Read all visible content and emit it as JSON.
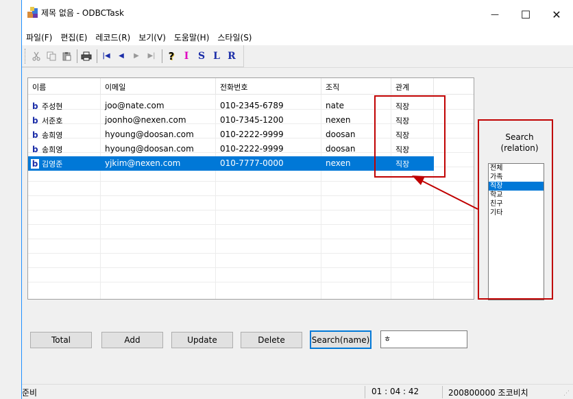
{
  "window": {
    "title": "제목 없음 - ODBCTask",
    "minimize_glyph": "—",
    "maximize_glyph": "☐",
    "close_glyph": "✕"
  },
  "menu": [
    {
      "label": "파일(F)"
    },
    {
      "label": "편집(E)"
    },
    {
      "label": "레코드(R)"
    },
    {
      "label": "보기(V)"
    },
    {
      "label": "도움말(H)"
    },
    {
      "label": "스타일(S)"
    }
  ],
  "toolbar": {
    "cut_icon": "scissors-icon",
    "copy_icon": "copy-icon",
    "paste_icon": "paste-icon",
    "print_icon": "printer-icon",
    "first_label": "|◀",
    "prev_label": "◀",
    "next_label": "▶",
    "last_label": "▶|",
    "help_label": "?",
    "letters": [
      "I",
      "S",
      "L",
      "R"
    ],
    "letter_colors": [
      "#e000c0",
      "#1c2ea8",
      "#1c2ea8",
      "#1c2ea8"
    ]
  },
  "list": {
    "columns": [
      "이름",
      "이메일",
      "전화번호",
      "조직",
      "관계"
    ],
    "rows": [
      {
        "mark": "b",
        "name": "주성현",
        "email": "joo@nate.com",
        "phone": "010-2345-6789",
        "org": "nate",
        "rel": "직장",
        "selected": false
      },
      {
        "mark": "b",
        "name": "서준호",
        "email": "joonho@nexen.com",
        "phone": "010-7345-1200",
        "org": "nexen",
        "rel": "직장",
        "selected": false
      },
      {
        "mark": "b",
        "name": "송희영",
        "email": "hyoung@doosan.com",
        "phone": "010-2222-9999",
        "org": "doosan",
        "rel": "직장",
        "selected": false
      },
      {
        "mark": "b",
        "name": "송희영",
        "email": "hyoung@doosan.com",
        "phone": "010-2222-9999",
        "org": "doosan",
        "rel": "직장",
        "selected": false
      },
      {
        "mark": "b",
        "name": "김영준",
        "email": "yjkim@nexen.com",
        "phone": "010-7777-0000",
        "org": "nexen",
        "rel": "직장",
        "selected": true
      }
    ]
  },
  "search_panel": {
    "label_line1": "Search",
    "label_line2": "(relation)",
    "options": [
      {
        "label": "전체",
        "selected": false
      },
      {
        "label": "가족",
        "selected": false
      },
      {
        "label": "직장",
        "selected": true
      },
      {
        "label": "학교",
        "selected": false
      },
      {
        "label": "친구",
        "selected": false
      },
      {
        "label": "기타",
        "selected": false
      }
    ]
  },
  "buttons": {
    "total": "Total",
    "add": "Add",
    "update": "Update",
    "delete": "Delete",
    "search_name": "Search(name)"
  },
  "search_input": {
    "value": "ㅎ"
  },
  "status": {
    "ready": "준비",
    "time": "01 : 04 : 42",
    "user": "200800000 조코비치"
  },
  "colors": {
    "selection": "#0078d7",
    "annotation": "#c00000"
  }
}
